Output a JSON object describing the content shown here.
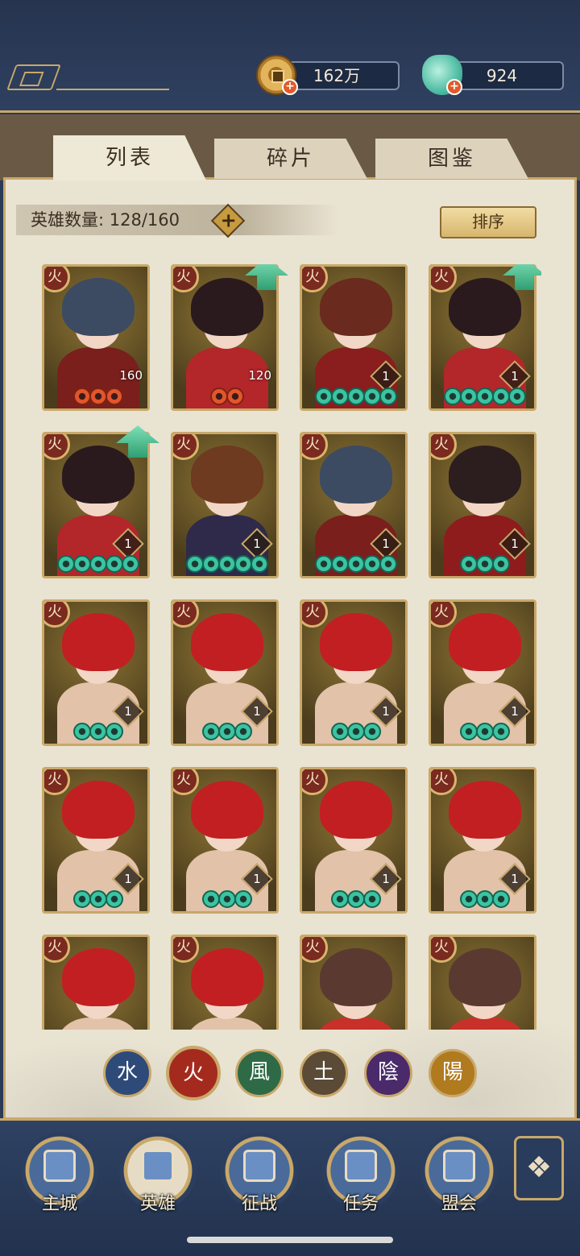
{
  "resources": {
    "coins": {
      "icon": "copper-coin-icon",
      "value": "162万"
    },
    "jade": {
      "icon": "jade-shell-icon",
      "value": "924"
    }
  },
  "tabs": [
    {
      "label": "列表",
      "active": true
    },
    {
      "label": "碎片",
      "active": false
    },
    {
      "label": "图鉴",
      "active": false
    }
  ],
  "hero_count": {
    "label": "英雄数量: 128/160",
    "add_icon": "plus-icon"
  },
  "sort_button": "排序",
  "heroes": [
    {
      "element": "火",
      "level": "160",
      "stars": 3,
      "star_color": "red",
      "upgrade": false,
      "hair": "#3c4b62",
      "body": "#7a1f1c"
    },
    {
      "element": "火",
      "level": "120",
      "stars": 2,
      "star_color": "red",
      "upgrade": true,
      "hair": "#2a1a1e",
      "body": "#b3262a"
    },
    {
      "element": "火",
      "level": "1",
      "stars": 5,
      "star_color": "green",
      "upgrade": false,
      "hair": "#6a2a1e",
      "body": "#8a1d1d"
    },
    {
      "element": "火",
      "level": "1",
      "stars": 5,
      "star_color": "green",
      "upgrade": true,
      "hair": "#2a1a1e",
      "body": "#b3262a"
    },
    {
      "element": "火",
      "level": "1",
      "stars": 5,
      "star_color": "green",
      "upgrade": true,
      "hair": "#2a1a1e",
      "body": "#b3262a"
    },
    {
      "element": "火",
      "level": "1",
      "stars": 5,
      "star_color": "green",
      "upgrade": false,
      "hair": "#6e3a20",
      "body": "#2f2a4a"
    },
    {
      "element": "火",
      "level": "1",
      "stars": 5,
      "star_color": "green",
      "upgrade": false,
      "hair": "#3c4b62",
      "body": "#7a1f1c"
    },
    {
      "element": "火",
      "level": "1",
      "stars": 3,
      "star_color": "green",
      "upgrade": false,
      "hair": "#2c1e1e",
      "body": "#8e1c1c"
    },
    {
      "element": "火",
      "level": "1",
      "stars": 3,
      "star_color": "green",
      "upgrade": false,
      "hair": "#c21f22",
      "body": "#e2c2a8"
    },
    {
      "element": "火",
      "level": "1",
      "stars": 3,
      "star_color": "green",
      "upgrade": false,
      "hair": "#c21f22",
      "body": "#e2c2a8"
    },
    {
      "element": "火",
      "level": "1",
      "stars": 3,
      "star_color": "green",
      "upgrade": false,
      "hair": "#c21f22",
      "body": "#e2c2a8"
    },
    {
      "element": "火",
      "level": "1",
      "stars": 3,
      "star_color": "green",
      "upgrade": false,
      "hair": "#c21f22",
      "body": "#e2c2a8"
    },
    {
      "element": "火",
      "level": "1",
      "stars": 3,
      "star_color": "green",
      "upgrade": false,
      "hair": "#c21f22",
      "body": "#e2c2a8"
    },
    {
      "element": "火",
      "level": "1",
      "stars": 3,
      "star_color": "green",
      "upgrade": false,
      "hair": "#c21f22",
      "body": "#e2c2a8"
    },
    {
      "element": "火",
      "level": "1",
      "stars": 3,
      "star_color": "green",
      "upgrade": false,
      "hair": "#c21f22",
      "body": "#e2c2a8"
    },
    {
      "element": "火",
      "level": "1",
      "stars": 3,
      "star_color": "green",
      "upgrade": false,
      "hair": "#c21f22",
      "body": "#e2c2a8"
    },
    {
      "element": "火",
      "level": "",
      "stars": 0,
      "star_color": "green",
      "upgrade": false,
      "hair": "#c21f22",
      "body": "#e2c2a8"
    },
    {
      "element": "火",
      "level": "",
      "stars": 0,
      "star_color": "green",
      "upgrade": false,
      "hair": "#c21f22",
      "body": "#e2c2a8"
    },
    {
      "element": "火",
      "level": "",
      "stars": 0,
      "star_color": "green",
      "upgrade": false,
      "hair": "#5a3a30",
      "body": "#c8302a"
    },
    {
      "element": "火",
      "level": "",
      "stars": 0,
      "star_color": "green",
      "upgrade": false,
      "hair": "#5a3a30",
      "body": "#c8302a"
    }
  ],
  "element_filters": [
    {
      "glyph": "水",
      "color": "#2e4a78",
      "active": false
    },
    {
      "glyph": "火",
      "color": "#a52a1e",
      "active": true
    },
    {
      "glyph": "風",
      "color": "#2e6a46",
      "active": false
    },
    {
      "glyph": "土",
      "color": "#5a4a36",
      "active": false
    },
    {
      "glyph": "陰",
      "color": "#4a2a6a",
      "active": false
    },
    {
      "glyph": "陽",
      "color": "#b07a1e",
      "active": false
    }
  ],
  "bottom_nav": [
    {
      "label": "主城",
      "icon": "city-gate-icon",
      "active": false
    },
    {
      "label": "英雄",
      "icon": "hero-portrait-icon",
      "active": true
    },
    {
      "label": "征战",
      "icon": "war-drum-icon",
      "active": false
    },
    {
      "label": "任务",
      "icon": "scroll-icon",
      "active": false
    },
    {
      "label": "盟会",
      "icon": "guild-hall-icon",
      "active": false
    }
  ],
  "menu_icon": "menu-grid-icon"
}
